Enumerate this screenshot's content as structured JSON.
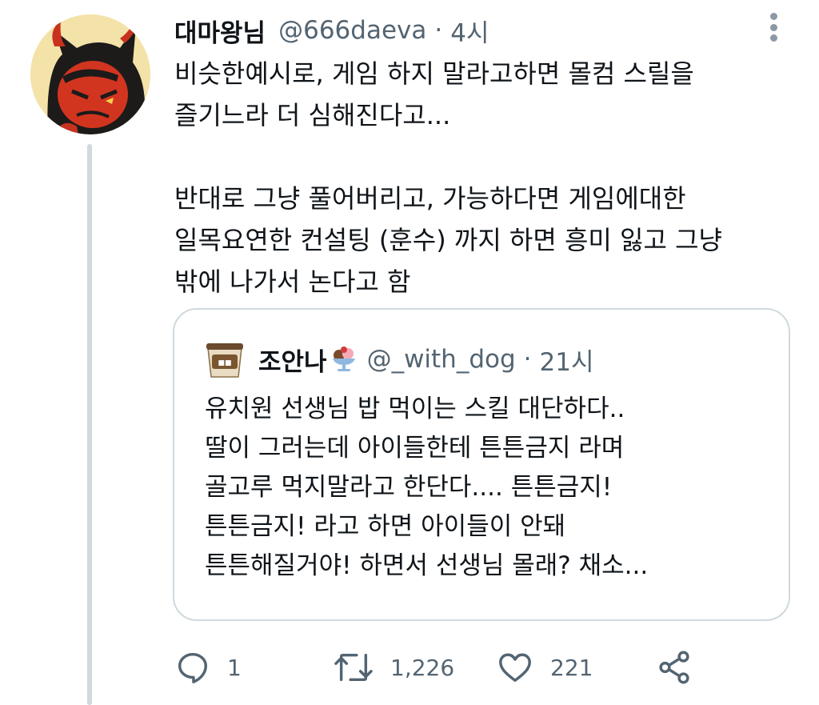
{
  "tweet": {
    "display_name": "대마왕님",
    "handle": "@666daeva",
    "separator": "·",
    "time": "4시",
    "lines": [
      "비슷한예시로, 게임 하지 말라고하면 몰컴 스릴을",
      "즐기느라 더 심해진다고...",
      "",
      "반대로 그냥 풀어버리고, 가능하다면 게임에대한",
      "일목요연한 컨설팅 (훈수) 까지 하면 흥미 잃고 그냥",
      "밖에 나가서 논다고 함"
    ]
  },
  "quote": {
    "display_name": "조안나",
    "emoji_icon": "ice-cream-sundae",
    "handle": "@_with_dog",
    "separator": "·",
    "time": "21시",
    "lines": [
      "유치원 선생님 밥 먹이는 스킬 대단하다..",
      "딸이 그러는데 아이들한테 튼튼금지 라며",
      "골고루 먹지말라고 한단다.... 튼튼금지!",
      "튼튼금지! 라고 하면 아이들이 안돼",
      "튼튼해질거야! 하면서 선생님 몰래? 채소..."
    ]
  },
  "actions": {
    "reply_count": "1",
    "retweet_count": "1,226",
    "like_count": "221"
  },
  "colors": {
    "text": "#0f1419",
    "secondary": "#536471",
    "border": "#cfd9de",
    "avatar_bg": "#f3e3a9"
  }
}
